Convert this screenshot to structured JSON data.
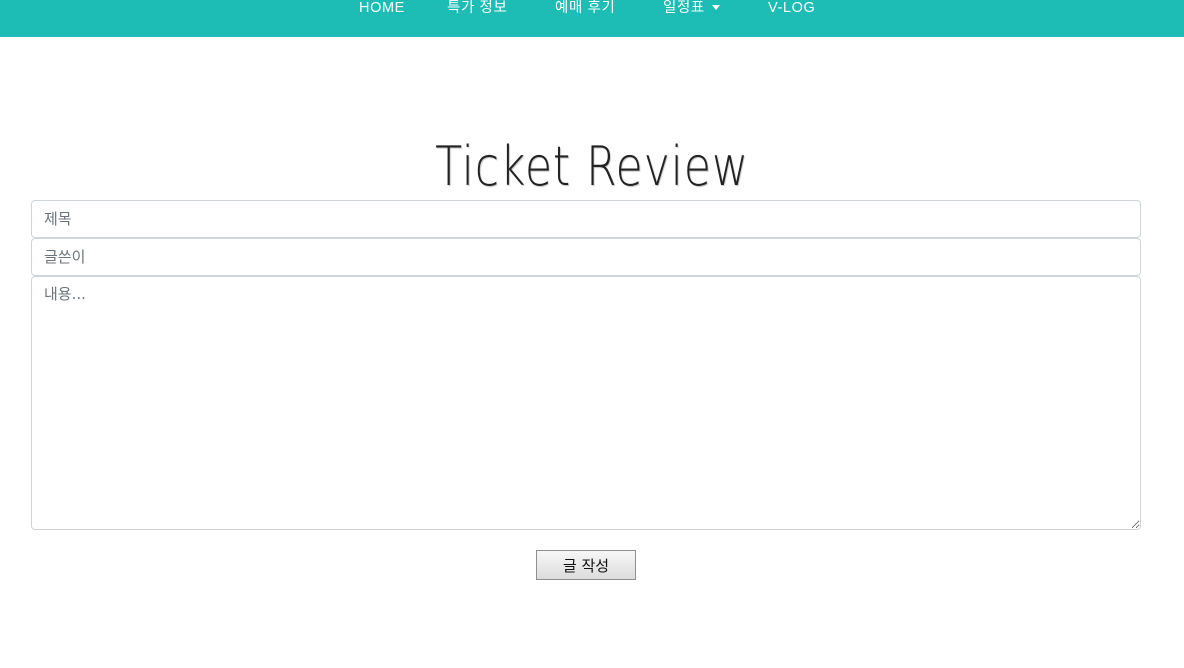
{
  "nav": {
    "items": [
      {
        "label": "HOME"
      },
      {
        "label": "특가 정보"
      },
      {
        "label": "예매 후기"
      },
      {
        "label": "일정표"
      },
      {
        "label": "V-LOG"
      }
    ],
    "background_color": "#1dbcb4"
  },
  "page": {
    "title": "Ticket Review"
  },
  "form": {
    "title_placeholder": "제목",
    "author_placeholder": "글쓴이",
    "content_placeholder": "내용...",
    "submit_label": "글 작성"
  }
}
